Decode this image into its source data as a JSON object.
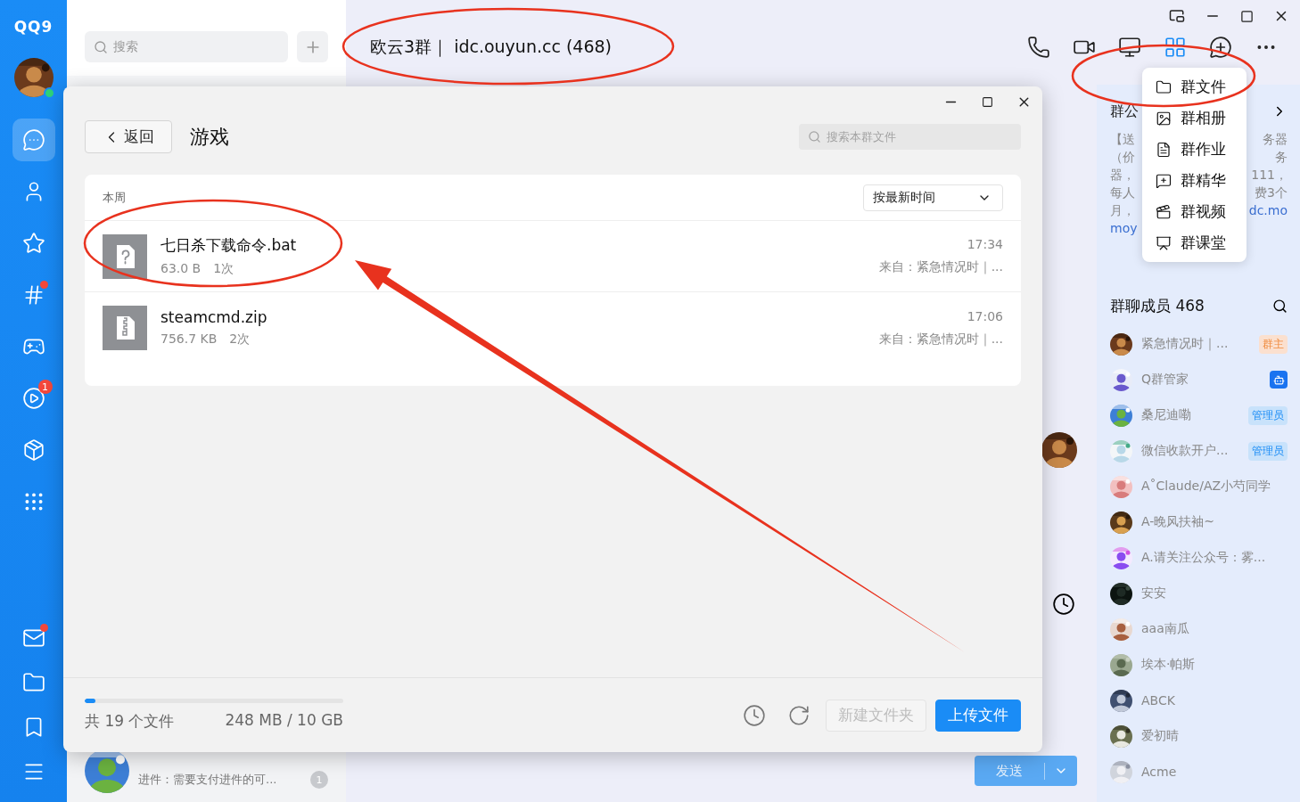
{
  "sidebar": {
    "logo": "QQ9",
    "online": true,
    "nav": [
      {
        "kind": "chat",
        "selected": true,
        "dot": false
      },
      {
        "kind": "contacts",
        "selected": false,
        "dot": false
      },
      {
        "kind": "star",
        "selected": false,
        "dot": false
      },
      {
        "kind": "channel",
        "selected": false,
        "dot": true
      },
      {
        "kind": "game",
        "selected": false,
        "dot": false
      },
      {
        "kind": "video",
        "selected": false,
        "dot": false,
        "badge": "1"
      },
      {
        "kind": "store",
        "selected": false,
        "dot": false
      },
      {
        "kind": "apps",
        "selected": false,
        "dot": false
      }
    ],
    "bottom_nav": [
      {
        "kind": "mail",
        "dot": true
      },
      {
        "kind": "folder",
        "dot": false
      },
      {
        "kind": "bookmark",
        "dot": false
      },
      {
        "kind": "menu",
        "dot": false
      }
    ]
  },
  "conversations": {
    "search": {
      "placeholder": "搜索"
    },
    "visible_item": {
      "preview": "进件：需要支付进件的可...",
      "unread": "1"
    }
  },
  "chat": {
    "title": "欧云3群｜ idc.ouyun.cc (468)",
    "toolbar": [
      {
        "kind": "phone",
        "selected": false
      },
      {
        "kind": "video",
        "selected": false
      },
      {
        "kind": "screen",
        "selected": false
      },
      {
        "kind": "apps",
        "selected": true
      },
      {
        "kind": "add",
        "selected": false
      },
      {
        "kind": "more",
        "selected": false
      }
    ],
    "send_button": {
      "label": "发送",
      "disabled": true
    }
  },
  "app_menu": [
    {
      "kind": "folder",
      "label": "群文件"
    },
    {
      "kind": "album",
      "label": "群相册"
    },
    {
      "kind": "homework",
      "label": "群作业"
    },
    {
      "kind": "essence",
      "label": "群精华"
    },
    {
      "kind": "video",
      "label": "群视频"
    },
    {
      "kind": "class",
      "label": "群课堂"
    }
  ],
  "announcement": {
    "title": "群公",
    "lines": [
      {
        "left": {
          "text": "【送",
          "link": false
        },
        "right": {
          "text": "务器",
          "link": false
        }
      },
      {
        "left": {
          "text": "（价",
          "link": false
        },
        "right": {
          "text": "务",
          "link": false
        }
      },
      {
        "left": {
          "text": "器，",
          "link": false
        },
        "right": {
          "text": "111，",
          "link": false
        }
      },
      {
        "left": {
          "text": "每人",
          "link": false
        },
        "right": {
          "text": "费3个",
          "link": false
        }
      },
      {
        "left": {
          "text": "月，",
          "link": false
        },
        "right": {
          "text": "dc.mo",
          "link": true
        }
      },
      {
        "left": {
          "text": "moy",
          "link": true
        }
      }
    ]
  },
  "members": {
    "title": "群聊成员 468",
    "list": [
      {
        "name": "紧急情况时｜...",
        "tag": {
          "kind": "owner",
          "label": "群主"
        }
      },
      {
        "name": "Q群管家",
        "tag": {
          "kind": "bot"
        }
      },
      {
        "name": "桑尼迪嘞",
        "tag": {
          "kind": "admin",
          "label": "管理员"
        }
      },
      {
        "name": "微信收款开户...",
        "tag": {
          "kind": "admin",
          "label": "管理员"
        }
      },
      {
        "name": "A˚Claude/AZ小芍同学"
      },
      {
        "name": "A-晚风扶袖~"
      },
      {
        "name": "A.请关注公众号：雾..."
      },
      {
        "name": "安安"
      },
      {
        "name": "aaa南瓜"
      },
      {
        "name": "埃本·帕斯"
      },
      {
        "name": "ABCK"
      },
      {
        "name": "爱初晴"
      },
      {
        "name": "Acme"
      }
    ]
  },
  "file_dialog": {
    "back_label": "返回",
    "folder": "游戏",
    "search": {
      "placeholder": "搜索本群文件"
    },
    "section": "本周",
    "sort": "按最新时间",
    "files": [
      {
        "kind": "unknown",
        "name": "七日杀下载命令.bat",
        "size": "63.0 B",
        "downloads": "1次",
        "time": "17:34",
        "source": "来自：紧急情况时｜..."
      },
      {
        "kind": "zip",
        "name": "steamcmd.zip",
        "size": "756.7 KB",
        "downloads": "2次",
        "time": "17:06",
        "source": "来自：紧急情况时｜..."
      }
    ],
    "storage": {
      "level": 0.04,
      "count": "共 19 个文件",
      "usage": "248 MB / 10 GB"
    },
    "buttons": [
      {
        "kind": "secondary",
        "label": "新建文件夹",
        "disabled": true
      },
      {
        "kind": "primary",
        "label": "上传文件",
        "disabled": false
      }
    ]
  },
  "annotations": [
    {
      "kind": "ellipse"
    },
    {
      "kind": "ellipse"
    },
    {
      "kind": "ellipse"
    },
    {
      "kind": "arrow"
    }
  ]
}
